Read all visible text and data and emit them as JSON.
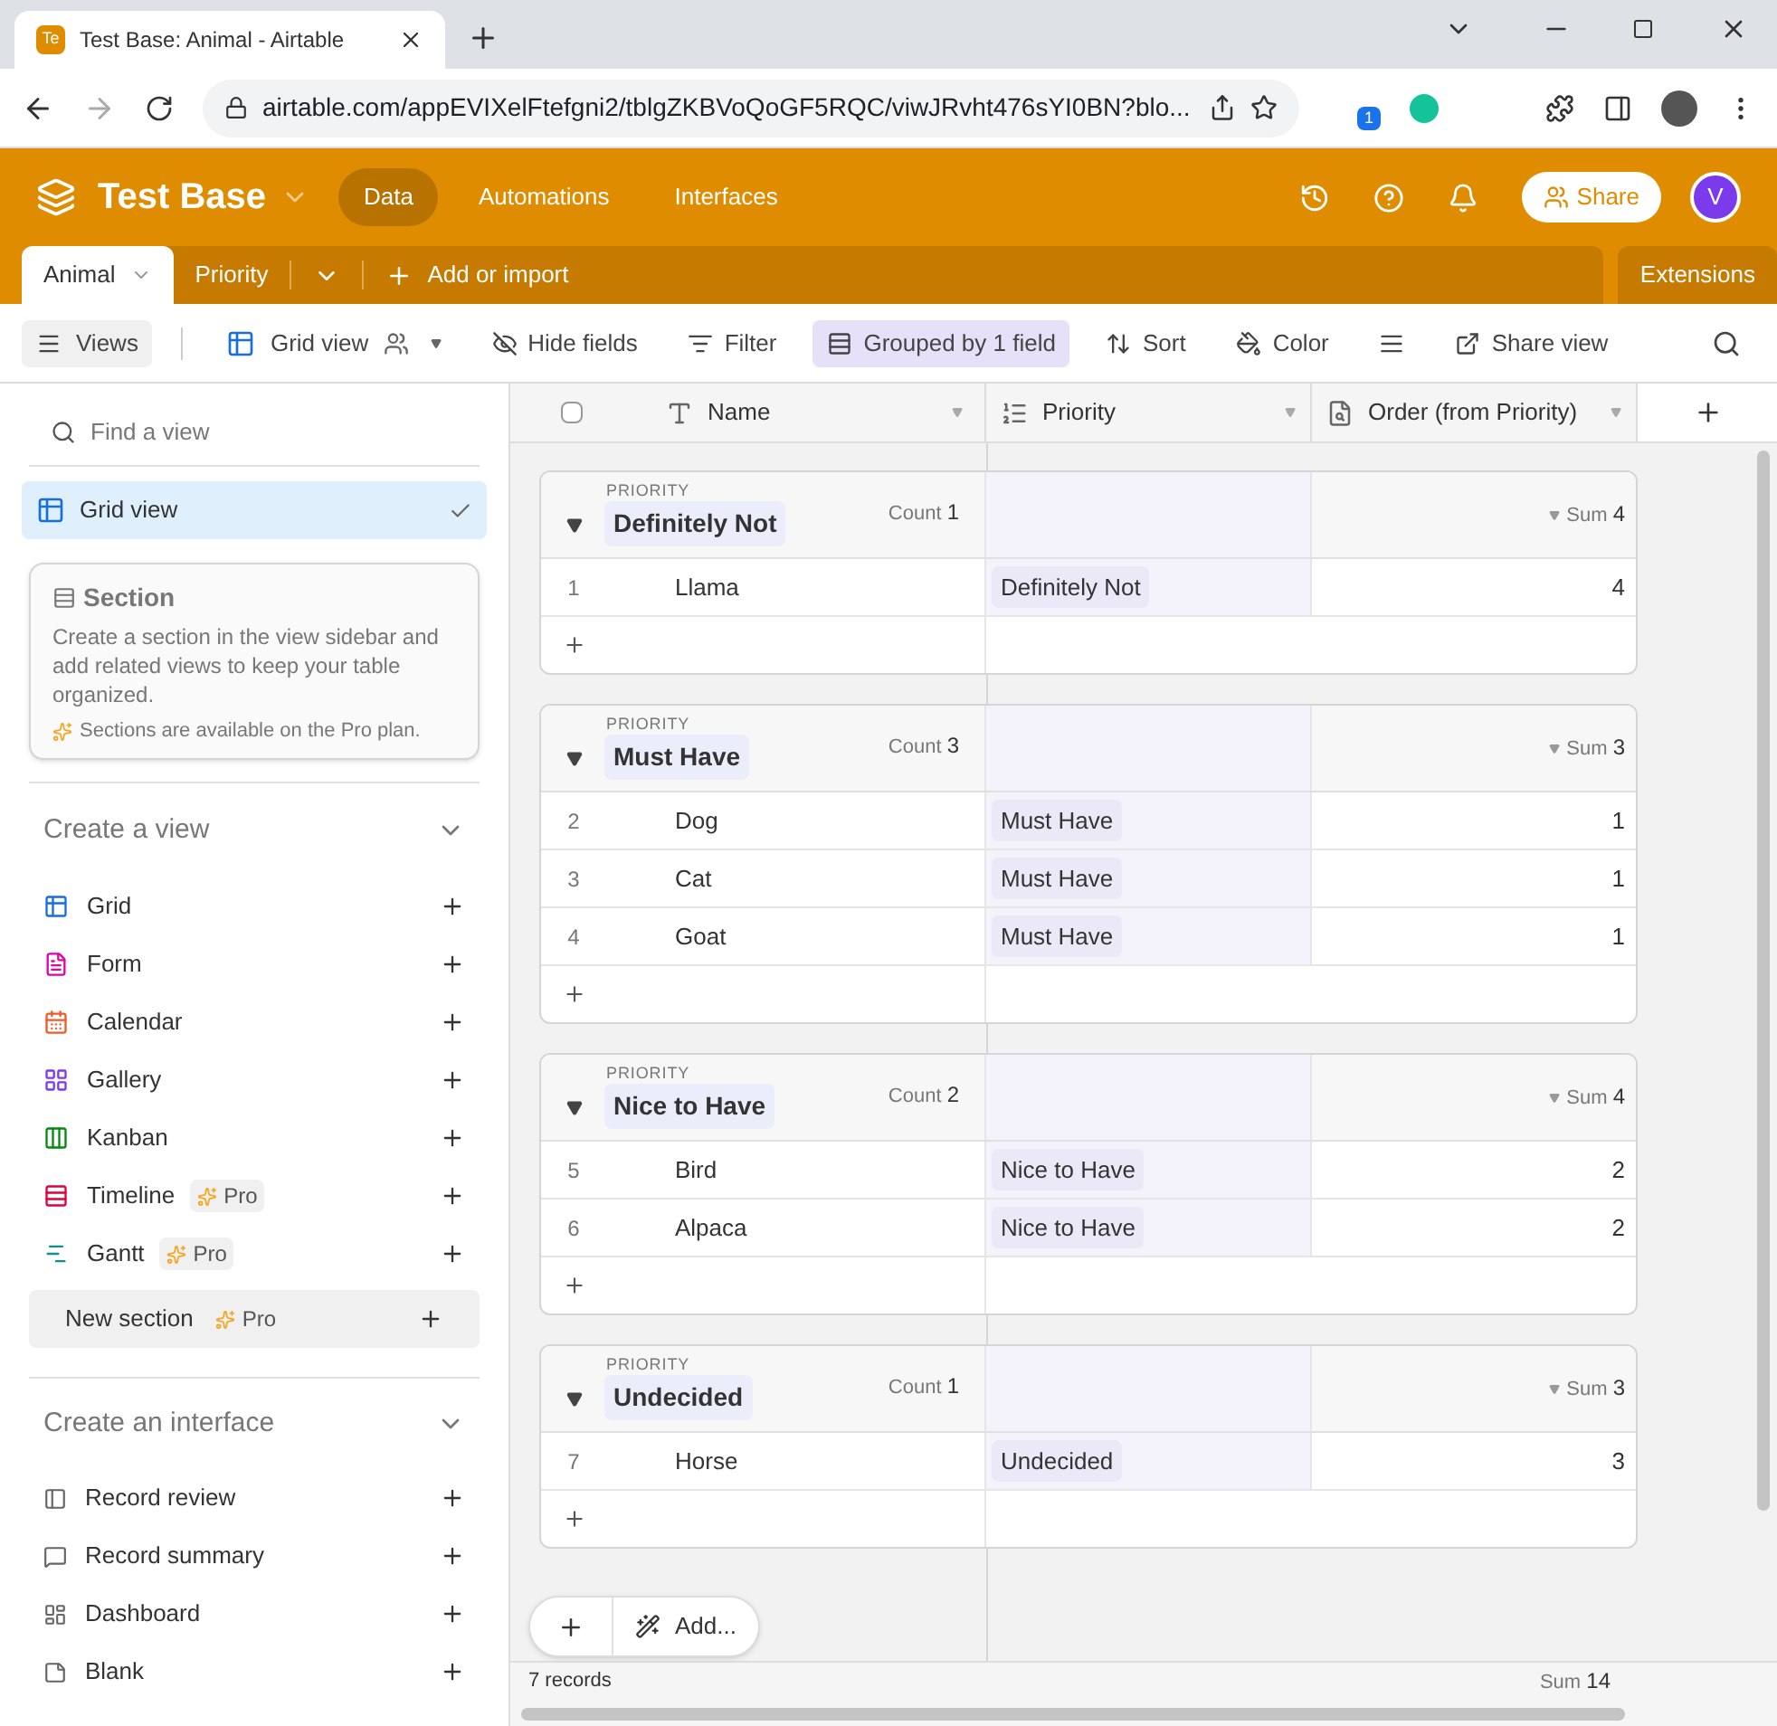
{
  "browser": {
    "tab_favicon": "Te",
    "tab_title": "Test Base: Animal - Airtable",
    "url": "airtable.com/appEVIXelFtefgni2/tblgZKBVoQoGF5RQC/viwJRvht476sYI0BN?blo...",
    "extension_badge": "1"
  },
  "header": {
    "base_name": "Test Base",
    "nav": [
      {
        "label": "Data",
        "selected": true
      },
      {
        "label": "Automations",
        "selected": false
      },
      {
        "label": "Interfaces",
        "selected": false
      }
    ],
    "share": "Share",
    "avatar": "V"
  },
  "tables": {
    "tabs": [
      {
        "label": "Animal",
        "selected": true
      },
      {
        "label": "Priority",
        "selected": false
      }
    ],
    "add_or_import": "Add or import",
    "extensions": "Extensions"
  },
  "toolbar": {
    "views": "Views",
    "view_name": "Grid view",
    "items": [
      {
        "kind": "hide",
        "label": "Hide fields",
        "active": false
      },
      {
        "kind": "filter",
        "label": "Filter",
        "active": false
      },
      {
        "kind": "group",
        "label": "Grouped by 1 field",
        "active": true
      },
      {
        "kind": "sort",
        "label": "Sort",
        "active": false
      },
      {
        "kind": "color",
        "label": "Color",
        "active": false
      },
      {
        "kind": "height",
        "active": false
      },
      {
        "kind": "share",
        "label": "Share view",
        "active": false
      }
    ]
  },
  "sidebar": {
    "search": {
      "placeholder": "Find a view"
    },
    "views": [
      {
        "label": "Grid view",
        "selected": true
      }
    ],
    "tooltip": {
      "title": "Section",
      "body": "Create a section in the view sidebar and add related views to keep your table organized.",
      "note": "Sections are available on the Pro plan."
    },
    "create_view": {
      "title": "Create a view",
      "items": [
        {
          "kind": "grid",
          "label": "Grid",
          "color": "#166ee1",
          "highlighted": false
        },
        {
          "kind": "form",
          "label": "Form",
          "color": "#dd04a8",
          "highlighted": false
        },
        {
          "kind": "calendar",
          "label": "Calendar",
          "color": "#f05a24",
          "highlighted": false
        },
        {
          "kind": "gallery",
          "label": "Gallery",
          "color": "#7c39ed",
          "highlighted": false
        },
        {
          "kind": "kanban",
          "label": "Kanban",
          "color": "#048a0e",
          "highlighted": false
        },
        {
          "kind": "timeline",
          "label": "Timeline",
          "color": "#dc043b",
          "badge": "Pro",
          "highlighted": false
        },
        {
          "kind": "gantt",
          "label": "Gantt",
          "color": "#0d9488",
          "badge": "Pro",
          "highlighted": false
        },
        {
          "kind": "section",
          "label": "New section",
          "badge": "Pro",
          "highlighted": true
        }
      ]
    },
    "create_interface": {
      "title": "Create an interface",
      "items": [
        {
          "kind": "review",
          "label": "Record review"
        },
        {
          "kind": "summary",
          "label": "Record summary"
        },
        {
          "kind": "dashboard",
          "label": "Dashboard"
        },
        {
          "kind": "blank",
          "label": "Blank"
        }
      ]
    }
  },
  "grid": {
    "select_all": {
      "checked": false
    },
    "columns": [
      {
        "kind": "text",
        "label": "Name"
      },
      {
        "kind": "select",
        "label": "Priority"
      },
      {
        "kind": "lookup",
        "label": "Order (from Priority)"
      }
    ],
    "groups": [
      {
        "field_label": "PRIORITY",
        "value": "Definitely Not",
        "count_label": "Count",
        "count": "1",
        "sum_label": "Sum",
        "sum": "4",
        "rows": [
          {
            "number": "1",
            "name": "Llama",
            "priority": "Definitely Not",
            "order": "4"
          }
        ]
      },
      {
        "field_label": "PRIORITY",
        "value": "Must Have",
        "count_label": "Count",
        "count": "3",
        "sum_label": "Sum",
        "sum": "3",
        "rows": [
          {
            "number": "2",
            "name": "Dog",
            "priority": "Must Have",
            "order": "1"
          },
          {
            "number": "3",
            "name": "Cat",
            "priority": "Must Have",
            "order": "1"
          },
          {
            "number": "4",
            "name": "Goat",
            "priority": "Must Have",
            "order": "1"
          }
        ]
      },
      {
        "field_label": "PRIORITY",
        "value": "Nice to Have",
        "count_label": "Count",
        "count": "2",
        "sum_label": "Sum",
        "sum": "4",
        "rows": [
          {
            "number": "5",
            "name": "Bird",
            "priority": "Nice to Have",
            "order": "2"
          },
          {
            "number": "6",
            "name": "Alpaca",
            "priority": "Nice to Have",
            "order": "2"
          }
        ]
      },
      {
        "field_label": "PRIORITY",
        "value": "Undecided",
        "count_label": "Count",
        "count": "1",
        "sum_label": "Sum",
        "sum": "3",
        "rows": [
          {
            "number": "7",
            "name": "Horse",
            "priority": "Undecided",
            "order": "3"
          }
        ]
      }
    ],
    "add_button": "Add...",
    "footer": {
      "records": "7 records",
      "sum_label": "Sum",
      "sum": "14"
    }
  }
}
